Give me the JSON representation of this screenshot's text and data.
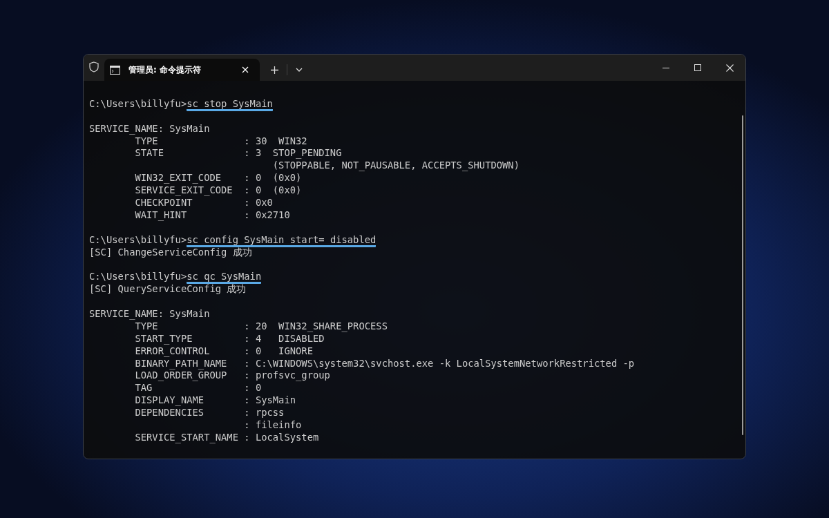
{
  "window": {
    "tab": {
      "title": "管理员: 命令提示符",
      "selected": true
    }
  },
  "terminal": {
    "lines": [
      {
        "kind": "blank"
      },
      {
        "kind": "prompt",
        "prompt": "C:\\Users\\billyfu>",
        "command": "sc stop SysMain",
        "underlined": true
      },
      {
        "kind": "blank"
      },
      {
        "kind": "output",
        "text": "SERVICE_NAME: SysMain"
      },
      {
        "kind": "output",
        "text": "        TYPE               : 30  WIN32"
      },
      {
        "kind": "output",
        "text": "        STATE              : 3  STOP_PENDING"
      },
      {
        "kind": "output",
        "text": "                                (STOPPABLE, NOT_PAUSABLE, ACCEPTS_SHUTDOWN)"
      },
      {
        "kind": "output",
        "text": "        WIN32_EXIT_CODE    : 0  (0x0)"
      },
      {
        "kind": "output",
        "text": "        SERVICE_EXIT_CODE  : 0  (0x0)"
      },
      {
        "kind": "output",
        "text": "        CHECKPOINT         : 0x0"
      },
      {
        "kind": "output",
        "text": "        WAIT_HINT          : 0x2710"
      },
      {
        "kind": "blank"
      },
      {
        "kind": "prompt",
        "prompt": "C:\\Users\\billyfu>",
        "command": "sc config SysMain start= disabled",
        "underlined": true
      },
      {
        "kind": "output",
        "text": "[SC] ChangeServiceConfig 成功"
      },
      {
        "kind": "blank"
      },
      {
        "kind": "prompt",
        "prompt": "C:\\Users\\billyfu>",
        "command": "sc qc SysMain",
        "underlined": true
      },
      {
        "kind": "output",
        "text": "[SC] QueryServiceConfig 成功"
      },
      {
        "kind": "blank"
      },
      {
        "kind": "output",
        "text": "SERVICE_NAME: SysMain"
      },
      {
        "kind": "output",
        "text": "        TYPE               : 20  WIN32_SHARE_PROCESS"
      },
      {
        "kind": "output",
        "text": "        START_TYPE         : 4   DISABLED"
      },
      {
        "kind": "output",
        "text": "        ERROR_CONTROL      : 0   IGNORE"
      },
      {
        "kind": "output",
        "text": "        BINARY_PATH_NAME   : C:\\WINDOWS\\system32\\svchost.exe -k LocalSystemNetworkRestricted -p"
      },
      {
        "kind": "output",
        "text": "        LOAD_ORDER_GROUP   : profsvc_group"
      },
      {
        "kind": "output",
        "text": "        TAG                : 0"
      },
      {
        "kind": "output",
        "text": "        DISPLAY_NAME       : SysMain"
      },
      {
        "kind": "output",
        "text": "        DEPENDENCIES       : rpcss"
      },
      {
        "kind": "output",
        "text": "                           : fileinfo"
      },
      {
        "kind": "output",
        "text": "        SERVICE_START_NAME : LocalSystem"
      }
    ]
  }
}
